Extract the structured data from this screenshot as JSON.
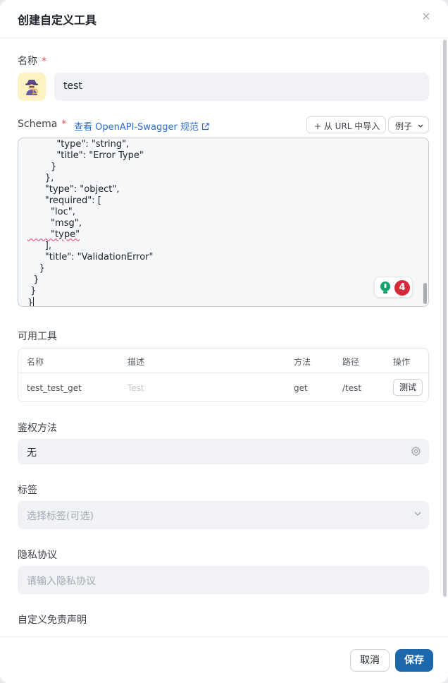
{
  "dialog": {
    "title": "创建自定义工具",
    "close_symbol": "×"
  },
  "name_section": {
    "label": "名称",
    "required_mark": "*",
    "value": "test"
  },
  "schema_section": {
    "label": "Schema",
    "required_mark": "*",
    "spec_link": "查看 OpenAPI-Swagger 规范",
    "import_url_button": "+ 从 URL 中导入",
    "example_button": "例子",
    "code_lines": [
      "          \"type\": \"string\",",
      "          \"title\": \"Error Type\"",
      "        }",
      "      },",
      "      \"type\": \"object\",",
      "      \"required\": [",
      "        \"loc\",",
      "        \"msg\",",
      "        \"type\"",
      "      ],",
      "      \"title\": \"ValidationError\"",
      "    }",
      "  }",
      " }",
      "}"
    ],
    "issue_count": "4"
  },
  "tools_section": {
    "label": "可用工具",
    "columns": [
      "名称",
      "描述",
      "方法",
      "路径",
      "操作"
    ],
    "rows": [
      {
        "name": "test_test_get",
        "description": "Test",
        "method": "get",
        "path": "/test",
        "action": "测试"
      }
    ]
  },
  "auth_section": {
    "label": "鉴权方法",
    "value": "无"
  },
  "tags_section": {
    "label": "标签",
    "placeholder": "选择标签(可选)"
  },
  "privacy_section": {
    "label": "隐私协议",
    "placeholder": "请输入隐私协议"
  },
  "disclaimer_section": {
    "label": "自定义免责声明"
  },
  "footer": {
    "cancel": "取消",
    "save": "保存"
  },
  "colors": {
    "primary": "#1d68ad",
    "link": "#2a6cd1",
    "required": "#e54848",
    "badge": "#d42b3a"
  }
}
